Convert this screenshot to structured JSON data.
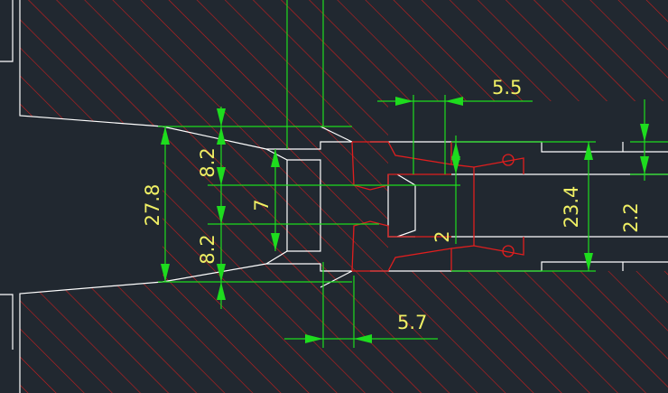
{
  "colors": {
    "background": "#212830",
    "hatch": "#c81e1e",
    "outline": "#ffffff",
    "dimension": "#1edc1e",
    "dimension_text": "#f0f064",
    "part_red": "#e01e1e"
  },
  "dimensions": {
    "top_width": "5.5",
    "bottom_width": "5.7",
    "left_height": "27.8",
    "upper_gap": "8.2",
    "lower_gap": "8.2",
    "center_height": "7",
    "right_height": "23.4",
    "right_small": "2.2",
    "inner_small": "2"
  }
}
